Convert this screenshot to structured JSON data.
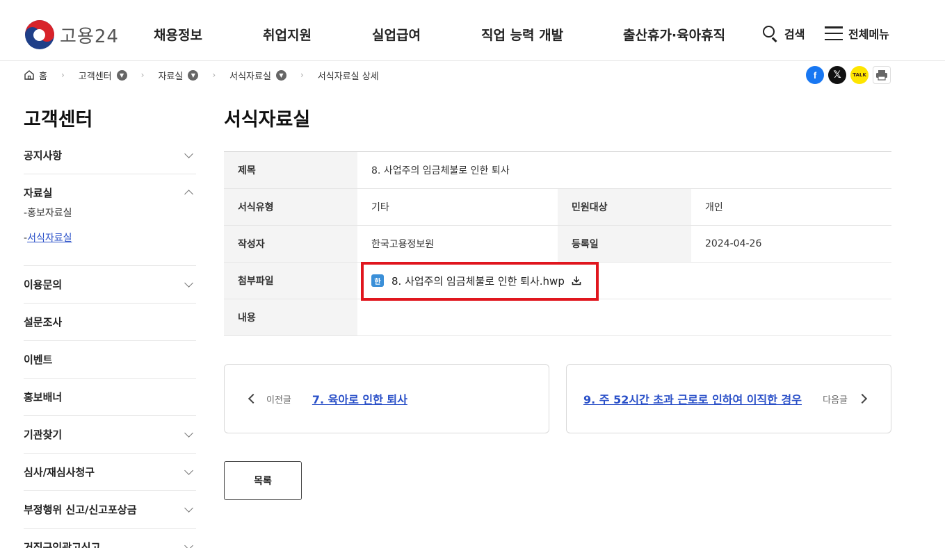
{
  "header": {
    "logo_text": "고용24",
    "nav": [
      "채용정보",
      "취업지원",
      "실업급여",
      "직업 능력 개발",
      "출산휴가·육아휴직"
    ],
    "search_label": "검색",
    "menu_label": "전체메뉴"
  },
  "breadcrumb": {
    "home": "홈",
    "items": [
      "고객센터",
      "자료실",
      "서식자료실",
      "서식자료실 상세"
    ]
  },
  "share": {
    "facebook": "f",
    "x": "𝕏",
    "kakao": "TALK",
    "print": "🖶"
  },
  "sidebar": {
    "title": "고객센터",
    "items": [
      {
        "label": "공지사항"
      },
      {
        "label": "자료실",
        "sub": [
          "홍보자료실",
          "서식자료실"
        ]
      },
      {
        "label": "이용문의"
      },
      {
        "label": "설문조사"
      },
      {
        "label": "이벤트"
      },
      {
        "label": "홍보배너"
      },
      {
        "label": "기관찾기"
      },
      {
        "label": "심사/재심사청구"
      },
      {
        "label": "부정행위 신고/신고포상금"
      },
      {
        "label": "거짓구인광고신고"
      }
    ]
  },
  "main": {
    "title": "서식자료실",
    "rows": {
      "subject_label": "제목",
      "subject_value": "8. 사업주의 임금체불로 인한 퇴사",
      "type_label": "서식유형",
      "type_value": "기타",
      "target_label": "민원대상",
      "target_value": "개인",
      "author_label": "작성자",
      "author_value": "한국고용정보원",
      "date_label": "등록일",
      "date_value": "2024-04-26",
      "file_label": "첨부파일",
      "file_icon": "한",
      "file_name": "8. 사업주의 임금체불로 인한 퇴사.hwp",
      "content_label": "내용",
      "content_value": ""
    },
    "prev": {
      "label": "이전글",
      "title": "7. 육아로 인한 퇴사"
    },
    "next": {
      "label": "다음글",
      "title": "9. 주 52시간 초과 근로로 인하여 이직한 경우"
    },
    "list_button": "목록"
  },
  "colors": {
    "link": "#2a50c8",
    "highlight_border": "#e0161e"
  }
}
